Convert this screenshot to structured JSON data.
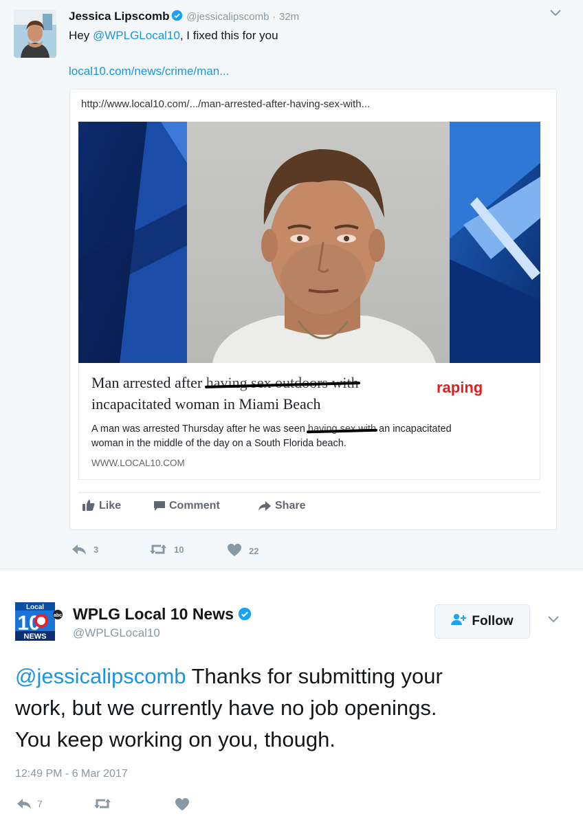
{
  "tweet1": {
    "name": "Jessica Lipscomb",
    "handle": "@jessicalipscomb",
    "separator": "·",
    "time": "32m",
    "text_prefix": "Hey ",
    "text_mention": "@WPLGLocal10",
    "text_suffix": ", I fixed this for you",
    "link": "local10.com/news/crime/man...",
    "card": {
      "url": "http://www.local10.com/.../man-arrested-after-having-sex-with...",
      "headline_start": "Man arrested after ",
      "headline_struck": "having sex outdoors with",
      "headline_line2": "incapacitated woman in Miami Beach",
      "handwritten_insert": "raping",
      "desc_start": "A man was arrested Thursday after he was seen ",
      "desc_struck": "having sex with",
      "desc_end": " an incapacitated",
      "desc_line2": "woman in the middle of the day on a South Florida beach.",
      "domain": "WWW.LOCAL10.COM",
      "actions": {
        "like": "Like",
        "comment": "Comment",
        "share": "Share"
      }
    },
    "stats": {
      "replies": "3",
      "retweets": "10",
      "likes": "22"
    }
  },
  "tweet2": {
    "name": "WPLG Local 10 News",
    "handle": "@WPLGLocal10",
    "follow_label": "Follow",
    "logo": {
      "top": "Local",
      "number": "10",
      "bottom": "NEWS",
      "network": "abc"
    },
    "text_mention": "@jessicalipscomb",
    "text_line1_rest": " Thanks for submitting your",
    "text_line2": "work, but we currently have no job openings.",
    "text_line3": "You keep working on you, though.",
    "timestamp": "12:49 PM - 6 Mar 2017",
    "stats": {
      "replies": "7"
    }
  },
  "icons": [
    "verified-badge-icon",
    "chevron-down-icon",
    "reply-icon",
    "retweet-icon",
    "heart-icon",
    "like-thumb-icon",
    "comment-icon",
    "share-arrow-icon",
    "follow-person-icon"
  ],
  "colors": {
    "link": "#1b95e0",
    "muted": "#8899a6",
    "annotation": "#e02020",
    "tweet_bg": "#f5f8fa"
  }
}
